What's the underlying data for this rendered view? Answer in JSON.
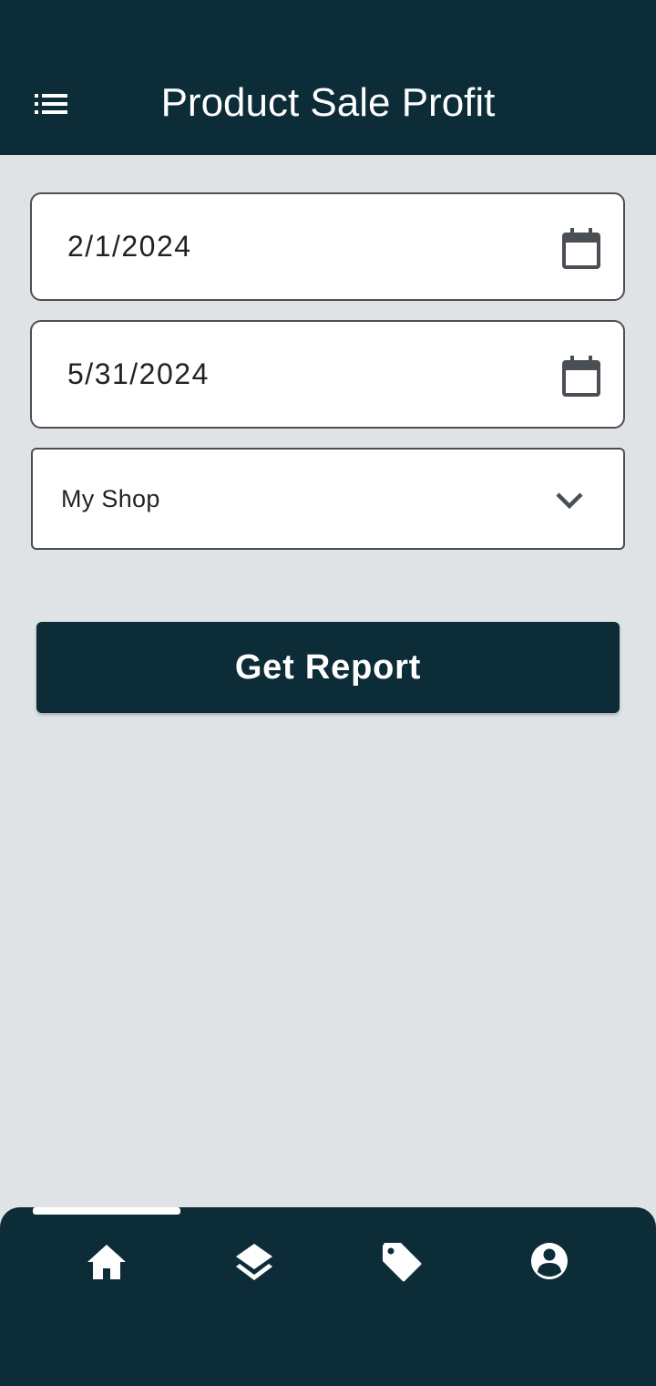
{
  "header": {
    "title": "Product Sale Profit",
    "menu_icon": "list-menu-icon"
  },
  "form": {
    "start_date": {
      "value": "2/1/2024",
      "icon": "calendar-icon"
    },
    "end_date": {
      "value": "5/31/2024",
      "icon": "calendar-icon"
    },
    "shop_select": {
      "selected": "My Shop",
      "icon": "chevron-down-icon"
    },
    "submit_label": "Get Report"
  },
  "bottom_nav": {
    "items": [
      {
        "icon": "home-icon",
        "active": true
      },
      {
        "icon": "layers-icon",
        "active": false
      },
      {
        "icon": "tag-icon",
        "active": false
      },
      {
        "icon": "account-circle-icon",
        "active": false
      }
    ]
  },
  "colors": {
    "primary": "#0c2c38",
    "background": "#dfe3e6",
    "field_border": "#4a4f55",
    "text": "#1f2326"
  }
}
